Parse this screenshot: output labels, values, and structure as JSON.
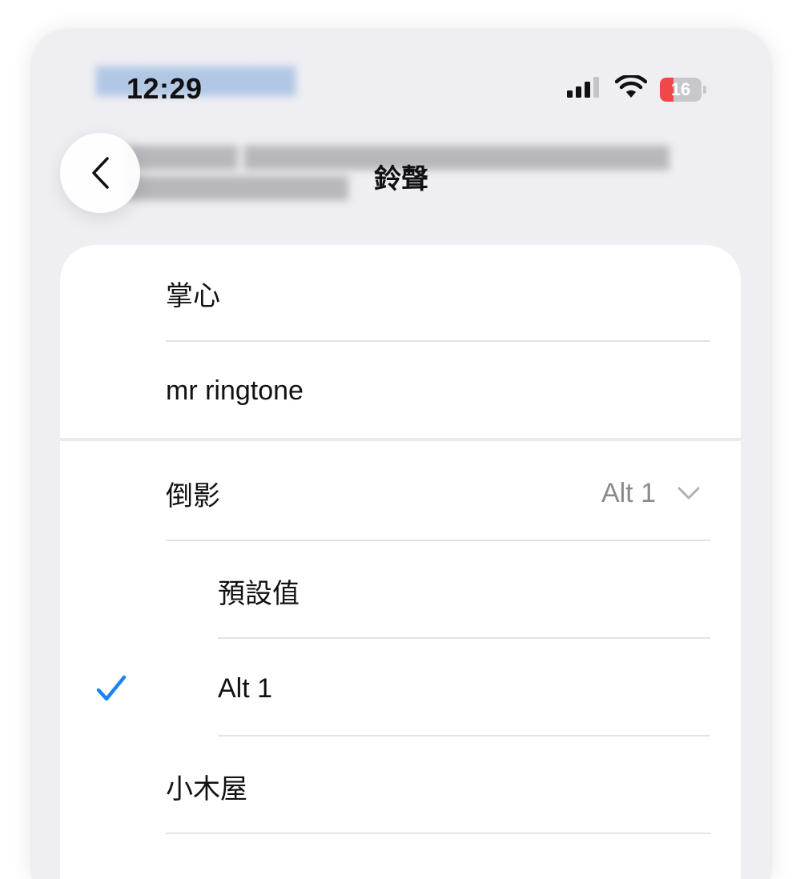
{
  "status_bar": {
    "time": "12:29",
    "battery_percent": "16",
    "battery_level": 0.16,
    "battery_color": "#f04848"
  },
  "nav": {
    "back_icon": "chevron-left-icon",
    "title": "鈴聲"
  },
  "ringtones": {
    "custom": [
      {
        "label": "掌心"
      },
      {
        "label": "mr ringtone"
      }
    ],
    "expanded": {
      "label": "倒影",
      "selected_value": "Alt 1",
      "chevron_icon": "chevron-down-icon",
      "variants": [
        {
          "label": "預設值",
          "checked": false
        },
        {
          "label": "Alt 1",
          "checked": true
        }
      ]
    },
    "more": [
      {
        "label": "小木屋"
      }
    ]
  },
  "colors": {
    "accent": "#1a84f5",
    "background": "#efeff3",
    "separator": "#e3e3e8"
  }
}
